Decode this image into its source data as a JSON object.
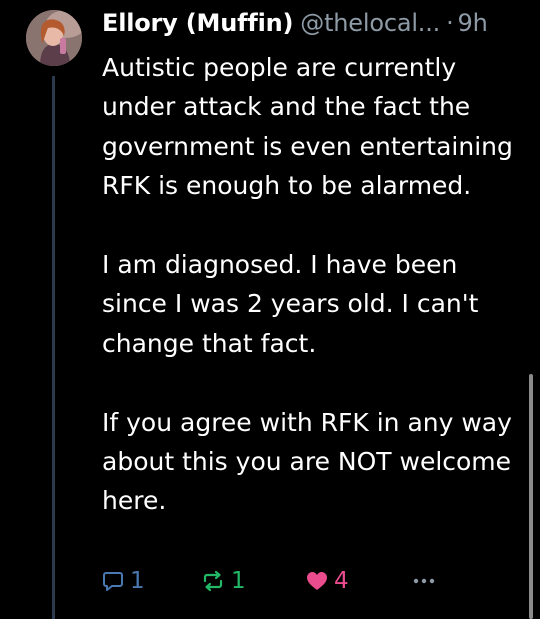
{
  "post": {
    "author": {
      "display_name": "Ellory (Muffin)",
      "handle": "@thelocal...",
      "separator": "·",
      "timestamp": "9h"
    },
    "paragraphs": [
      "Autistic people are currently under attack and the fact the government is even entertaining RFK is enough to be alarmed.",
      "I am diagnosed. I have been since I was 2 years old. I can't change that fact.",
      "If you agree with RFK in any way about this you are NOT welcome here."
    ],
    "actions": {
      "reply": {
        "icon": "reply-bubble-icon",
        "count": "1"
      },
      "repost": {
        "icon": "repost-icon",
        "count": "1"
      },
      "like": {
        "icon": "heart-icon",
        "count": "4",
        "liked": true
      },
      "more": {
        "icon": "more-horizontal-icon"
      }
    }
  },
  "colors": {
    "background": "#000000",
    "text": "#ffffff",
    "muted": "#8e9aa6",
    "reply": "#4a78b0",
    "repost": "#22b865",
    "like": "#ea4c8e",
    "thread_line": "#2c3a4d"
  }
}
